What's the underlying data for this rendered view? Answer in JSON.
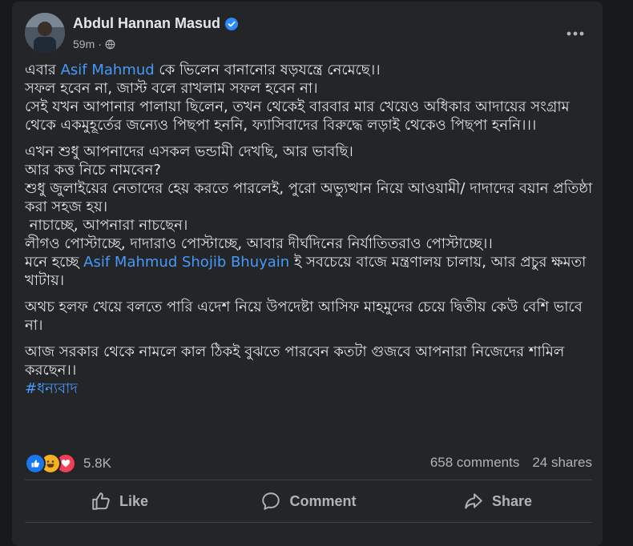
{
  "post": {
    "author": "Abdul Hannan Masud",
    "time": "59m",
    "paragraphs": [
      [
        {
          "pre": "এবার ",
          "link": "Asif Mahmud",
          "post": " কে ভিলেন বানানোর ষড়যন্ত্রে নেমেছে।।"
        },
        {
          "text": "সফল হবেন না, জাস্ট বলে রাখলাম সফল হবেন না।"
        },
        {
          "text": "সেই যখন আপানার পালায়া ছিলেন, তখন থেকেই বারবার মার খেয়েও অধিকার আদায়ের সংগ্রাম থেকে একমুহূর্তের জন্যেও পিছপা হননি, ফ্যাসিবাদের বিরুদ্ধে লড়াই থেকেও পিছপা হননি।।।"
        }
      ],
      [
        {
          "text": "এখন শুধু আপনাদের এসকল ভন্ডামী দেখছি, আর ভাবছি।"
        },
        {
          "text": "আর কত্ত নিচে নামবেন?"
        },
        {
          "text": "শুধু জুলাইয়ের নেতাদের হেয় করতে পারলেই, পুরো অভ্যুত্থান নিয়ে আওয়ামী/ দাদাদের বয়ান প্রতিষ্ঠা করা সহজ হয়।"
        },
        {
          "text": " নাচাচ্ছে, আপনারা নাচছেন।"
        },
        {
          "text": "লীগও পোস্টাচ্ছে, দাদারাও পোস্টাচ্ছে, আবার দীর্ঘদিনের নির্যাতিতরাও পোস্টাচ্ছে।।"
        },
        {
          "pre": "মনে হচ্ছে ",
          "link": "Asif Mahmud Shojib Bhuyain",
          "post": " ই সবচেয়ে বাজে মন্ত্রণালয় চালায়, আর প্রচুর ক্ষমতা খাটায়।"
        }
      ],
      [
        {
          "text": "অথচ হলফ খেয়ে বলতে পারি এদেশ নিয়ে উপদেষ্টা আসিফ মাহমুদের চেয়ে দ্বিতীয় কেউ বেশি ভাবে না।"
        }
      ],
      [
        {
          "text": "আজ সরকার থেকে নামলে কাল ঠিকই বুঝতে পারবেন কতটা গুজবে আপনারা নিজেদের শামিল করছেন।।"
        },
        {
          "link": "#ধন্যবাদ"
        }
      ]
    ]
  },
  "stats": {
    "reaction_count": "5.8K",
    "comments": "658 comments",
    "shares": "24 shares"
  },
  "actions": {
    "like": "Like",
    "comment": "Comment",
    "share": "Share"
  },
  "colors": {
    "link": "#4599ff",
    "verified": "#2d88ff",
    "like_reaction": "#1877f2",
    "love_reaction": "#f33e58",
    "haha_reaction": "#f7b125"
  }
}
